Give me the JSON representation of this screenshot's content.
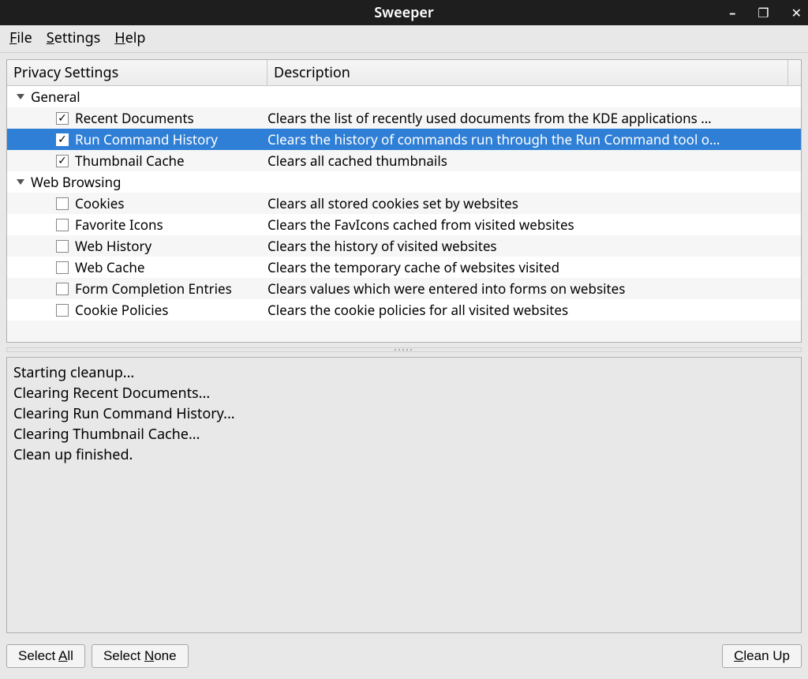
{
  "window": {
    "title": "Sweeper"
  },
  "menubar": {
    "file": "File",
    "settings": "Settings",
    "help": "Help"
  },
  "headers": {
    "col1": "Privacy Settings",
    "col2": "Description"
  },
  "groups": [
    {
      "name": "General",
      "items": [
        {
          "label": "Recent Documents",
          "checked": true,
          "selected": false,
          "desc": "Clears the list of recently used documents from the KDE applications …"
        },
        {
          "label": "Run Command History",
          "checked": true,
          "selected": true,
          "desc": "Clears the history of commands run through the Run Command tool o…"
        },
        {
          "label": "Thumbnail Cache",
          "checked": true,
          "selected": false,
          "desc": "Clears all cached thumbnails"
        }
      ]
    },
    {
      "name": "Web Browsing",
      "items": [
        {
          "label": "Cookies",
          "checked": false,
          "selected": false,
          "desc": "Clears all stored cookies set by websites"
        },
        {
          "label": "Favorite Icons",
          "checked": false,
          "selected": false,
          "desc": "Clears the FavIcons cached from visited websites"
        },
        {
          "label": "Web History",
          "checked": false,
          "selected": false,
          "desc": "Clears the history of visited websites"
        },
        {
          "label": "Web Cache",
          "checked": false,
          "selected": false,
          "desc": "Clears the temporary cache of websites visited"
        },
        {
          "label": "Form Completion Entries",
          "checked": false,
          "selected": false,
          "desc": "Clears values which were entered into forms on websites"
        },
        {
          "label": "Cookie Policies",
          "checked": false,
          "selected": false,
          "desc": "Clears the cookie policies for all visited websites"
        }
      ]
    }
  ],
  "log": "Starting cleanup...\nClearing Recent Documents...\nClearing Run Command History...\nClearing Thumbnail Cache...\nClean up finished.",
  "buttons": {
    "select_all": "Select All",
    "select_none": "Select None",
    "clean_up": "Clean Up"
  }
}
